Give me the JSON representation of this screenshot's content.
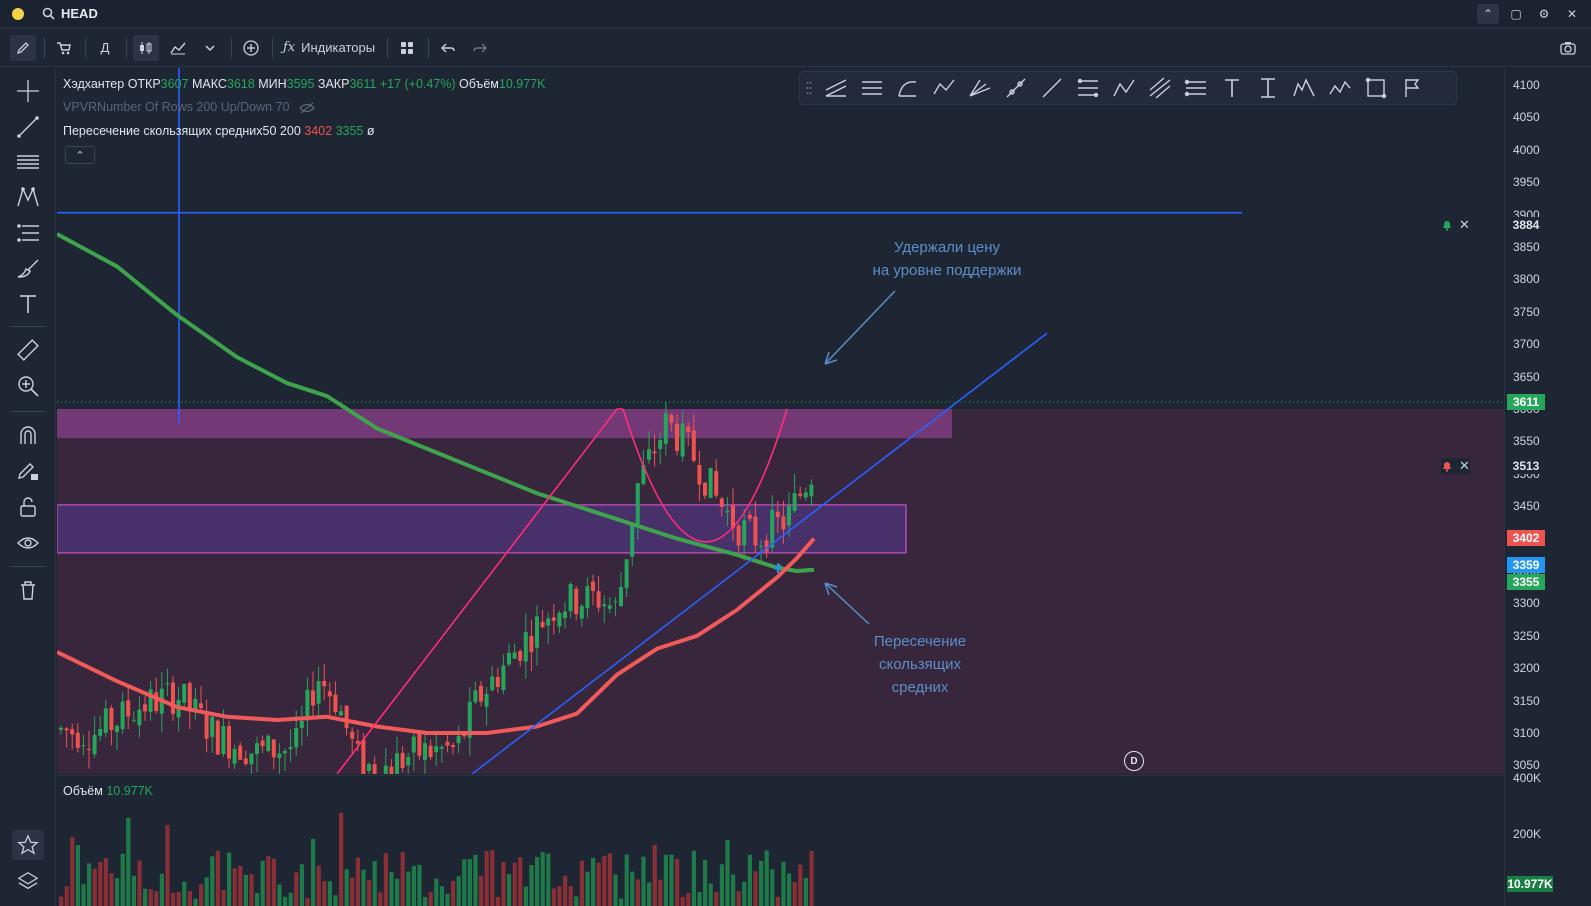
{
  "window": {
    "symbol": "HEAD",
    "dot_color": "#f5d547"
  },
  "toolbar": {
    "period": "Д",
    "indicators": "Индикаторы"
  },
  "legend": {
    "name": "Хэдхантер",
    "open_label": "ОТКР",
    "open": "3607",
    "high_label": "МАКС",
    "high": "3618",
    "low_label": "МИН",
    "low": "3595",
    "close_label": "ЗАКР",
    "close": "3611",
    "change": "+17 (+0.47%)",
    "volume_label": "Объём",
    "volume": "10.977K",
    "vpvr": "VPVRNumber Of Rows 200 Up/Down 70",
    "ma_name": "Пересечение скользящих средних50 200",
    "ma50": "3402",
    "ma200": "3355",
    "ma_null": "ø"
  },
  "annotations": {
    "support_line1": "Удержали цену",
    "support_line2": "на уровне поддержки",
    "cross_line1": "Пересечение",
    "cross_line2": "скользящих",
    "cross_line3": "средних"
  },
  "price_axis": {
    "ticks": [
      "4100",
      "4050",
      "4000",
      "3950",
      "3900",
      "3850",
      "3800",
      "3750",
      "3700",
      "3650",
      "3600",
      "3550",
      "3500",
      "3450",
      "3400",
      "3350",
      "3300",
      "3250",
      "3200",
      "3150",
      "3100",
      "3050"
    ],
    "tags": [
      {
        "text": "3884",
        "color": "#1e2533",
        "fg": "#e1e6ee"
      },
      {
        "text": "3611",
        "color": "#26a65b",
        "fg": "#ffffff"
      },
      {
        "text": "3513",
        "color": "#1e2533",
        "fg": "#e1e6ee"
      },
      {
        "text": "3402",
        "color": "#ef5350",
        "fg": "#ffffff"
      },
      {
        "text": "3359",
        "color": "#2196f3",
        "fg": "#ffffff"
      },
      {
        "text": "3355",
        "color": "#26a65b",
        "fg": "#ffffff"
      }
    ]
  },
  "volume_pane": {
    "label": "Объём",
    "value": "10.977K",
    "ticks": [
      "400K",
      "200K"
    ],
    "tag": "10.977K"
  },
  "marker": {
    "text": "D"
  },
  "colors": {
    "bg": "#1e2533",
    "up": "#26a65b",
    "down": "#ef5350",
    "ma50": "#f05a5a",
    "ma200": "#3fa34d",
    "trend": "#2962ff",
    "zone": "#b04bb0",
    "pattern": "#ff2d7a",
    "annotation": "#5a8fc9"
  }
}
